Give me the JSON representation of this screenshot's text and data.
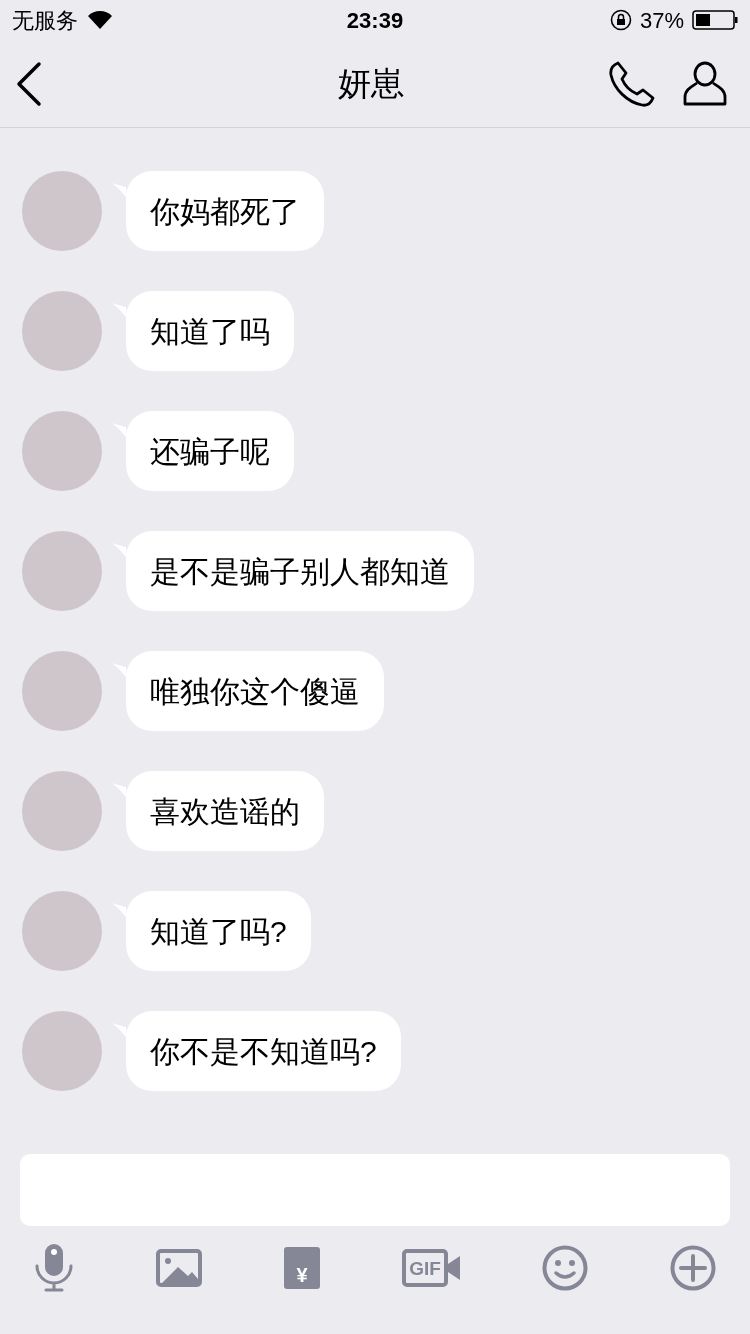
{
  "status_bar": {
    "carrier": "无服务",
    "time": "23:39",
    "battery": "37%"
  },
  "nav": {
    "title": "妍崽"
  },
  "messages": [
    {
      "text": "你妈都死了"
    },
    {
      "text": "知道了吗"
    },
    {
      "text": "还骗子呢"
    },
    {
      "text": "是不是骗子别人都知道"
    },
    {
      "text": "唯独你这个傻逼"
    },
    {
      "text": "喜欢造谣的"
    },
    {
      "text": "知道了吗?"
    },
    {
      "text": "你不是不知道吗?"
    }
  ],
  "toolbar": [
    {
      "kind": "mic"
    },
    {
      "kind": "image"
    },
    {
      "kind": "redpacket",
      "label": "¥"
    },
    {
      "kind": "gif",
      "label": "GIF"
    },
    {
      "kind": "emoji"
    },
    {
      "kind": "plus"
    }
  ]
}
